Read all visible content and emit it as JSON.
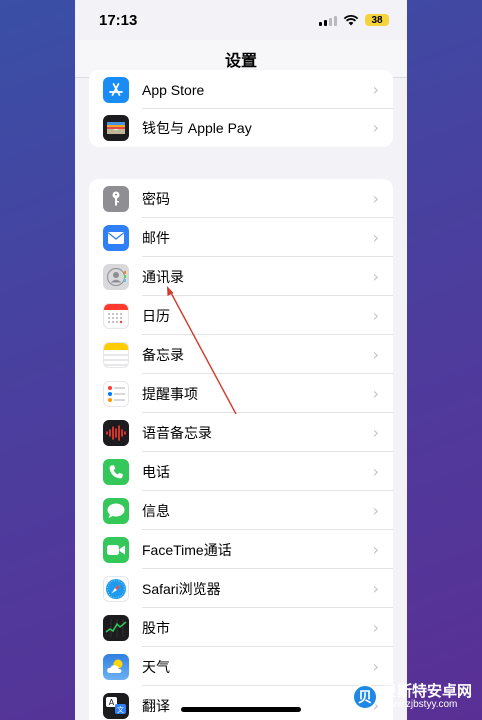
{
  "status_bar": {
    "time": "17:13",
    "battery_level": "38",
    "battery_color": "#f5d33a"
  },
  "nav": {
    "title": "设置"
  },
  "groups": [
    {
      "items": [
        {
          "label": "App Store",
          "icon": "app-store-icon",
          "color": "#1a8cf5"
        },
        {
          "label": "钱包与 Apple Pay",
          "icon": "wallet-icon",
          "color": "#1c1c1e"
        }
      ]
    },
    {
      "items": [
        {
          "label": "密码",
          "icon": "key-icon",
          "color": "#8e8e93"
        },
        {
          "label": "邮件",
          "icon": "mail-icon",
          "color": "#2f7ff6"
        },
        {
          "label": "通讯录",
          "icon": "contacts-icon",
          "color": "#d9d9dc"
        },
        {
          "label": "日历",
          "icon": "calendar-icon",
          "color": "#ffffff"
        },
        {
          "label": "备忘录",
          "icon": "notes-icon",
          "color": "#ffffff"
        },
        {
          "label": "提醒事项",
          "icon": "reminders-icon",
          "color": "#ffffff"
        },
        {
          "label": "语音备忘录",
          "icon": "voice-memos-icon",
          "color": "#1c1c1e"
        },
        {
          "label": "电话",
          "icon": "phone-icon",
          "color": "#34c759"
        },
        {
          "label": "信息",
          "icon": "messages-icon",
          "color": "#34c759"
        },
        {
          "label": "FaceTime通话",
          "icon": "facetime-icon",
          "color": "#34c759"
        },
        {
          "label": "Safari浏览器",
          "icon": "safari-icon",
          "color": "#ffffff"
        },
        {
          "label": "股市",
          "icon": "stocks-icon",
          "color": "#1c1c1e"
        },
        {
          "label": "天气",
          "icon": "weather-icon",
          "color": "#3d8fe0"
        },
        {
          "label": "翻译",
          "icon": "translate-icon",
          "color": "#1c1c1e"
        }
      ]
    }
  ],
  "annotation": {
    "arrow_color": "#d33a2c"
  },
  "watermark": {
    "logo_glyph": "贝",
    "name": "贝斯特安卓网",
    "url": "www.zjbstyy.com"
  }
}
